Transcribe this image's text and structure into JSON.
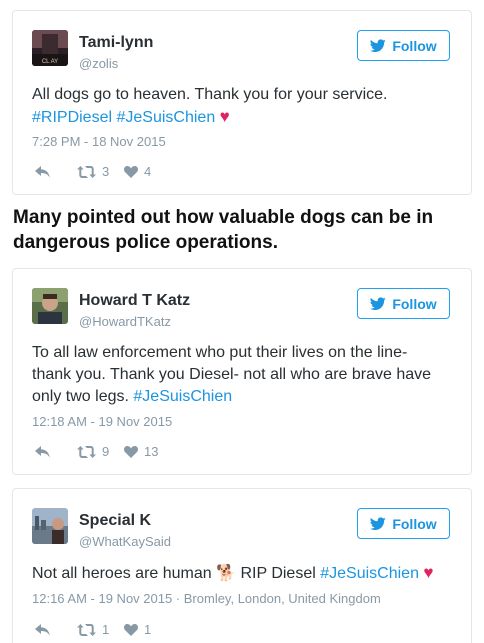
{
  "tweets": [
    {
      "display_name": "Tami-lynn",
      "handle": "@zolis",
      "follow_label": "Follow",
      "text_parts": {
        "line1": "All dogs go to heaven. Thank you for your service.",
        "tag1": "#RIPDiesel",
        "tag2": "#JeSuisChien",
        "heart": "♥"
      },
      "meta": "7:28 PM - 18 Nov 2015",
      "retweets": "3",
      "likes": "4",
      "avatar_text": "CL  AY"
    },
    {
      "display_name": "Howard T Katz",
      "handle": "@HowardTKatz",
      "follow_label": "Follow",
      "text_parts": {
        "line1": "To all law enforcement who put their lives on the line-",
        "line2": "thank you. Thank you Diesel- not all who are brave have",
        "line3": "only two legs.",
        "tag1": "#JeSuisChien"
      },
      "meta": "12:18 AM - 19 Nov 2015",
      "retweets": "9",
      "likes": "13"
    },
    {
      "display_name": "Special K",
      "handle": "@WhatKaySaid",
      "follow_label": "Follow",
      "text_parts": {
        "line1a": "Not all heroes are human",
        "dog": "🐕",
        "line1b": "RIP Diesel",
        "tag1": "#JeSuisChien",
        "heart": "♥"
      },
      "meta": "12:16 AM - 19 Nov 2015 · Bromley, London, United Kingdom",
      "retweets": "1",
      "likes": "1"
    }
  ],
  "caption": {
    "line1": "Many pointed out how valuable dogs can be in",
    "line2": "dangerous police operations."
  },
  "colors": {
    "accent": "#1b95e0",
    "heart": "#e0245e",
    "muted": "#8899a6",
    "border": "#e1e8ed"
  }
}
